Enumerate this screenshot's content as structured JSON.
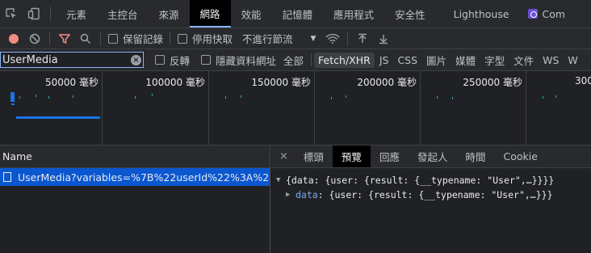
{
  "tabbar": {
    "tabs": [
      "元素",
      "主控台",
      "來源",
      "網路",
      "效能",
      "記憶體",
      "應用程式",
      "安全性",
      "Lighthouse",
      "Com"
    ],
    "active_index": 3
  },
  "toolbar": {
    "preserve_log": "保留記錄",
    "disable_cache": "停用快取",
    "throttling": "不進行節流"
  },
  "filter": {
    "value": "UserMedia",
    "invert": "反轉",
    "hide_data_urls": "隱藏資料網址",
    "types": [
      "全部",
      "Fetch/XHR",
      "JS",
      "CSS",
      "圖片",
      "媒體",
      "字型",
      "文件",
      "WS",
      "W"
    ],
    "active_type": "Fetch/XHR"
  },
  "timeline": {
    "ticks": [
      "50000 毫秒",
      "100000 毫秒",
      "150000 毫秒",
      "200000 毫秒",
      "250000 毫秒",
      "300"
    ]
  },
  "requests": {
    "header": "Name",
    "rows": [
      "UserMedia?variables=%7B%22userId%22%3A%22..."
    ]
  },
  "detail": {
    "close": "×",
    "tabs": [
      "標頭",
      "預覽",
      "回應",
      "發起人",
      "時間",
      "Cookie"
    ],
    "active_tab": "預覽",
    "preview": {
      "line1": "{data: {user: {result: {__typename: \"User\",…}}}}",
      "line2_key": "data",
      "line2_rest": ": {user: {result: {__typename: \"User\",…}}}"
    }
  },
  "colors": {
    "accent": "#8ab4f8",
    "record": "#f28b82",
    "filter_icon": "#f28b82",
    "selected_row": "#0b57d0"
  }
}
